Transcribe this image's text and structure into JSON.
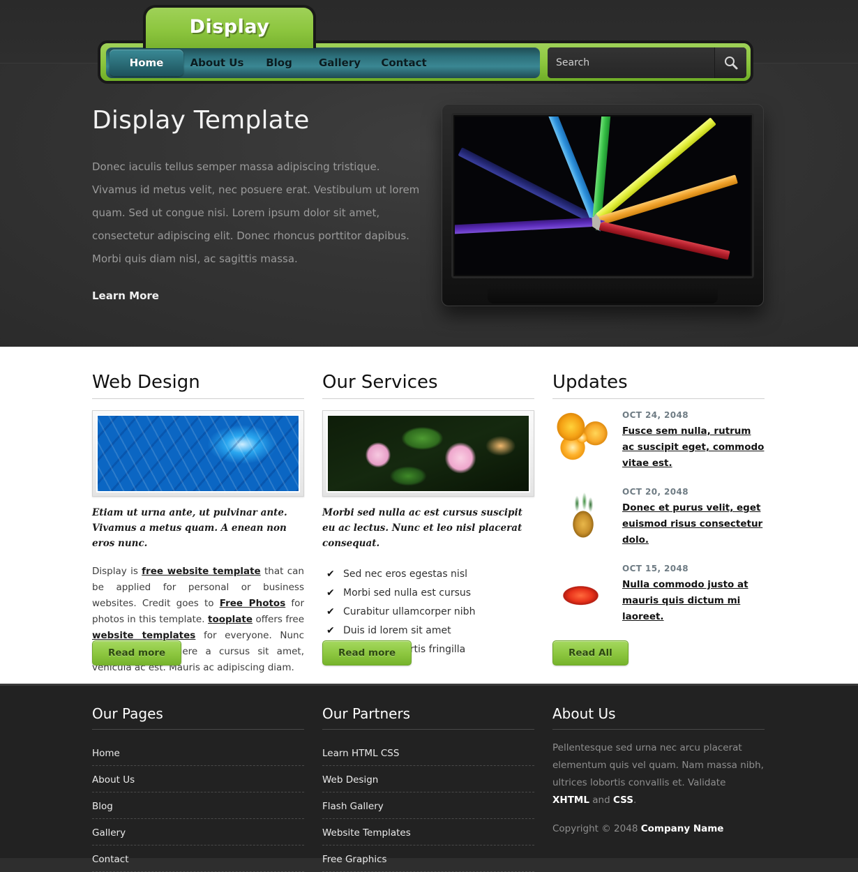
{
  "header": {
    "logo_text": "Display",
    "nav_items": [
      {
        "label": "Home",
        "active": true
      },
      {
        "label": "About Us",
        "active": false
      },
      {
        "label": "Blog",
        "active": false
      },
      {
        "label": "Gallery",
        "active": false
      },
      {
        "label": "Contact",
        "active": false
      }
    ],
    "search": {
      "placeholder": "Search",
      "value": "",
      "icon": "search-icon"
    }
  },
  "hero": {
    "title": "Display Template",
    "paragraph": "Donec iaculis tellus semper massa adipiscing tristique. Vivamus id metus velit, nec posuere erat. Vestibulum ut lorem quam. Sed ut congue nisi. Lorem ipsum dolor sit amet, consectetur adipiscing elit. Donec rhoncus porttitor dapibus. Morbi quis diam nisl, ac sagittis massa.",
    "link_label": "Learn More",
    "image_alt": "colored-pencils-on-monitor"
  },
  "main": {
    "web_design": {
      "title": "Web Design",
      "image_alt": "blue-water-drops-photo",
      "caption": "Etiam ut urna ante, ut pulvinar ante. Vivamus a metus quam. A enean non eros nunc.",
      "body_parts": [
        {
          "text": "Display is ",
          "link": false
        },
        {
          "text": "free website template",
          "link": true
        },
        {
          "text": " that can be applied for personal or business websites. Credit goes to ",
          "link": false
        },
        {
          "text": "Free Photos",
          "link": true
        },
        {
          "text": " for photos in this template. ",
          "link": false
        },
        {
          "text": "tooplate",
          "link": true
        },
        {
          "text": " offers free ",
          "link": false
        },
        {
          "text": "website templates",
          "link": true
        },
        {
          "text": " for everyone. Nunc risus tortor, posuere a cursus sit amet, vehicula ac est. Mauris ac adipiscing diam.",
          "link": false
        }
      ],
      "button_label": "Read more"
    },
    "our_services": {
      "title": "Our Services",
      "image_alt": "pink-lantana-flowers-photo",
      "caption": "Morbi sed nulla ac est cursus suscipit eu ac lectus. Nunc et leo nisl placerat consequat.",
      "items": [
        "Sed nec eros egestas nisl",
        "Morbi sed nulla est cursus",
        "Curabitur ullamcorper nibh",
        "Duis id lorem sit amet",
        "Praesent lobortis fringilla"
      ],
      "check_icon": "✔",
      "button_label": "Read more"
    },
    "updates": {
      "title": "Updates",
      "items": [
        {
          "date": "OCT 24, 2048",
          "text": "Fusce sem nulla, rutrum ac suscipit eget, commodo vitae est.",
          "image_alt": "oranges-photo"
        },
        {
          "date": "OCT 20, 2048",
          "text": "Donec et purus velit, eget euismod risus consectetur dolo.",
          "image_alt": "pineapple-photo"
        },
        {
          "date": "OCT 15, 2048",
          "text": "Nulla commodo justo at mauris quis dictum mi laoreet.",
          "image_alt": "strawberry-photo"
        }
      ],
      "button_label": "Read All"
    }
  },
  "footer": {
    "our_pages": {
      "title": "Our Pages",
      "links": [
        "Home",
        "About Us",
        "Blog",
        "Gallery",
        "Contact"
      ]
    },
    "our_partners": {
      "title": "Our Partners",
      "links": [
        "Learn HTML CSS",
        "Web Design",
        "Flash Gallery",
        "Website Templates",
        "Free Graphics"
      ]
    },
    "about_us": {
      "title": "About Us",
      "text_1": "Pellentesque sed urna nec arcu placerat elementum quis vel quam. Nam massa nibh, ultrices lobortis convallis et. Validate ",
      "link_1": "XHTML",
      "text_2": " and ",
      "link_2": "CSS",
      "text_3": ".",
      "copyright_prefix": "Copyright © 2048 ",
      "company": "Company Name"
    }
  },
  "colors": {
    "accent_green": "#8cc63f",
    "nav_teal": "#2d707b",
    "dark_bg": "#2e2e2e",
    "footer_bg": "#222222",
    "date_gray": "#6f7c84"
  }
}
